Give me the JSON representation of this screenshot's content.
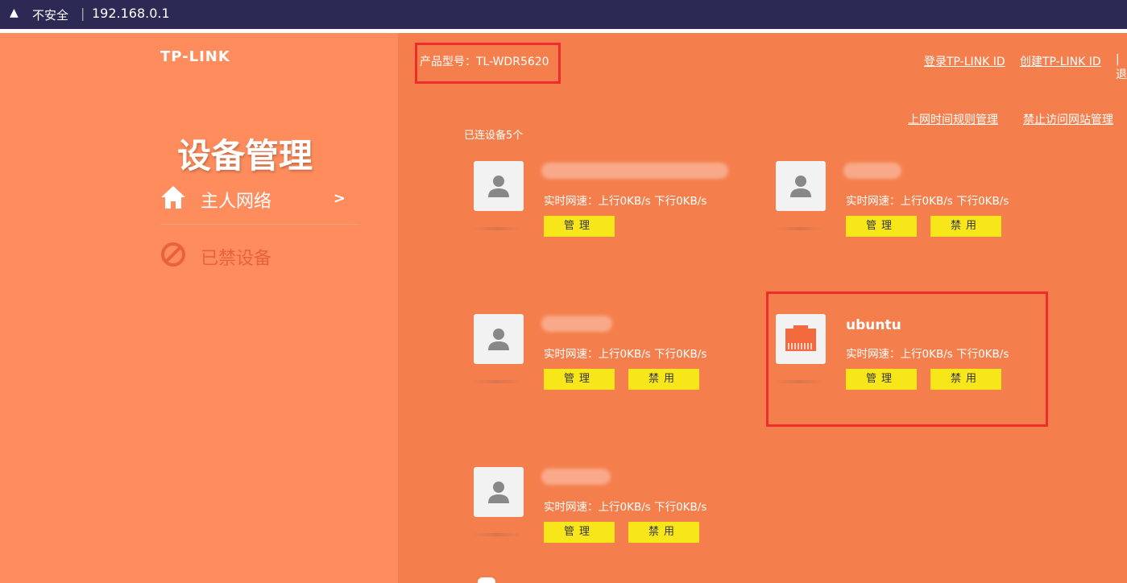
{
  "browser": {
    "warning_icon": "warning-triangle-icon",
    "security_label": "不安全",
    "separator": "|",
    "url": "192.168.0.1"
  },
  "sidebar": {
    "logo": "TP-LINK",
    "title": "设备管理",
    "items": [
      {
        "label": "主人网络",
        "icon": "home-icon",
        "arrow": ">"
      },
      {
        "label": "已禁设备",
        "icon": "forbidden-icon"
      }
    ]
  },
  "header": {
    "model": "产品型号：TL-WDR5620",
    "links": [
      "登录TP-LINK ID",
      "创建TP-LINK ID",
      "|退"
    ]
  },
  "main": {
    "sub_links": [
      "上网时间规则管理",
      "禁止访问网站管理"
    ],
    "connected_count": "已连设备5个",
    "devices": [
      {
        "name": "",
        "icon": "person-icon",
        "speed": "实时网速：上行0KB/s  下行0KB/s",
        "manage": "管理",
        "disable": ""
      },
      {
        "name": "",
        "icon": "person-icon",
        "speed": "实时网速：上行0KB/s  下行0KB/s",
        "manage": "管理",
        "disable": "禁用"
      },
      {
        "name": "",
        "icon": "person-icon",
        "speed": "实时网速：上行0KB/s  下行0KB/s",
        "manage": "管理",
        "disable": "禁用"
      },
      {
        "name": "ubuntu",
        "icon": "ethernet-port-icon",
        "speed": "实时网速：上行0KB/s  下行0KB/s",
        "manage": "管理",
        "disable": "禁用"
      },
      {
        "name": "",
        "icon": "person-icon",
        "speed": "实时网速：上行0KB/s  下行0KB/s",
        "manage": "管理",
        "disable": "禁用"
      }
    ]
  },
  "colors": {
    "sidebar_bg": "#ff8c5c",
    "main_bg": "#f47f4c",
    "button_yellow": "#f7e61a",
    "highlight_red": "#f02d2d"
  }
}
